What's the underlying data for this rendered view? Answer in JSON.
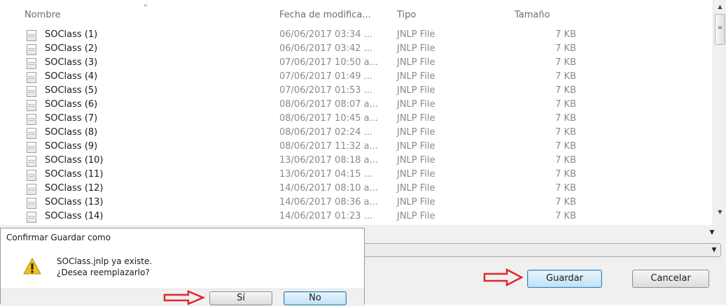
{
  "file_list": {
    "headers": {
      "name": "Nombre",
      "date": "Fecha de modifica...",
      "type": "Tipo",
      "size": "Tamaño"
    },
    "rows": [
      {
        "name": "SOClass (1)",
        "date": "06/06/2017 03:34 ...",
        "type": "JNLP File",
        "size": "7 KB"
      },
      {
        "name": "SOClass (2)",
        "date": "06/06/2017 03:42 ...",
        "type": "JNLP File",
        "size": "7 KB"
      },
      {
        "name": "SOClass (3)",
        "date": "07/06/2017 10:50 a...",
        "type": "JNLP File",
        "size": "7 KB"
      },
      {
        "name": "SOClass (4)",
        "date": "07/06/2017 01:49 ...",
        "type": "JNLP File",
        "size": "7 KB"
      },
      {
        "name": "SOClass (5)",
        "date": "07/06/2017 01:53 ...",
        "type": "JNLP File",
        "size": "7 KB"
      },
      {
        "name": "SOClass (6)",
        "date": "08/06/2017 08:07 a...",
        "type": "JNLP File",
        "size": "7 KB"
      },
      {
        "name": "SOClass (7)",
        "date": "08/06/2017 10:45 a...",
        "type": "JNLP File",
        "size": "7 KB"
      },
      {
        "name": "SOClass (8)",
        "date": "08/06/2017 02:24 ...",
        "type": "JNLP File",
        "size": "7 KB"
      },
      {
        "name": "SOClass (9)",
        "date": "08/06/2017 11:32 a...",
        "type": "JNLP File",
        "size": "7 KB"
      },
      {
        "name": "SOClass (10)",
        "date": "13/06/2017 08:18 a...",
        "type": "JNLP File",
        "size": "7 KB"
      },
      {
        "name": "SOClass (11)",
        "date": "13/06/2017 04:15 ...",
        "type": "JNLP File",
        "size": "7 KB"
      },
      {
        "name": "SOClass (12)",
        "date": "14/06/2017 08:10 a...",
        "type": "JNLP File",
        "size": "7 KB"
      },
      {
        "name": "SOClass (13)",
        "date": "14/06/2017 08:36 a...",
        "type": "JNLP File",
        "size": "7 KB"
      },
      {
        "name": "SOClass (14)",
        "date": "14/06/2017 01:23 ...",
        "type": "JNLP File",
        "size": "7 KB"
      }
    ]
  },
  "save_panel": {
    "save_label": "Guardar",
    "cancel_label": "Cancelar"
  },
  "confirm_dialog": {
    "title": "Confirmar Guardar como",
    "message_line1": "SOClass.jnlp ya existe.",
    "message_line2": "¿Desea reemplazarlo?",
    "yes_label": "Sí",
    "no_label": "No"
  },
  "icons": {
    "file": "jnlp-file-icon",
    "warning": "warning-icon",
    "annotation": "red-arrow-annotation"
  },
  "colors": {
    "annotation_red": "#e0262b",
    "warning_yellow": "#f2c21b"
  }
}
